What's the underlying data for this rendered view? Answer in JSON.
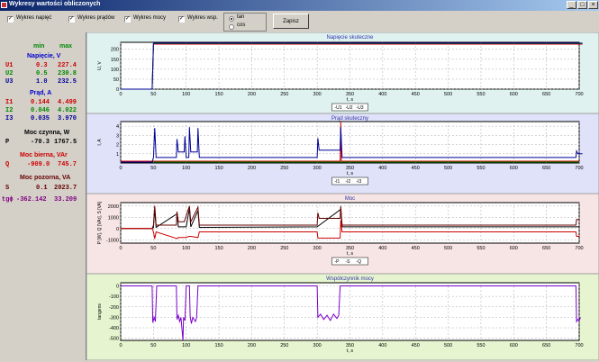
{
  "window": {
    "title": "Wykresy wartości obliczonych",
    "buttons": [
      "_",
      "□",
      "×"
    ]
  },
  "toolbar": {
    "checkboxes": [
      {
        "label": "Wykres napięć",
        "checked": true
      },
      {
        "label": "Wykres prądów",
        "checked": true
      },
      {
        "label": "Wykres mocy",
        "checked": true
      },
      {
        "label": "Wykres wsp.",
        "checked": true
      }
    ],
    "radios": [
      {
        "label": "tan",
        "selected": true
      },
      {
        "label": "cos",
        "selected": false
      }
    ],
    "save_label": "Zapisz"
  },
  "summary": {
    "col_min": "min",
    "col_max": "max",
    "sections": [
      {
        "title": "Napięcie, V",
        "title_color": "#0000cc",
        "rows": [
          {
            "label": "U1",
            "min": "0.3",
            "max": "227.4",
            "color": "#cc0000"
          },
          {
            "label": "U2",
            "min": "0.5",
            "max": "230.8",
            "color": "#008800"
          },
          {
            "label": "U3",
            "min": "1.0",
            "max": "232.5",
            "color": "#000099"
          }
        ]
      },
      {
        "title": "Prąd, A",
        "title_color": "#0000cc",
        "rows": [
          {
            "label": "I1",
            "min": "0.144",
            "max": "4.499",
            "color": "#cc0000"
          },
          {
            "label": "I2",
            "min": "0.046",
            "max": "4.022",
            "color": "#008800"
          },
          {
            "label": "I3",
            "min": "0.035",
            "max": "3.970",
            "color": "#000099"
          }
        ]
      },
      {
        "title": "Moc czynna, W",
        "title_color": "#000000",
        "rows": [
          {
            "label": "P",
            "min": "-70.3",
            "max": "1767.5",
            "color": "#000000"
          }
        ]
      },
      {
        "title": "Moc bierna, VAr",
        "title_color": "#cc0000",
        "rows": [
          {
            "label": "Q",
            "min": "-909.0",
            "max": "745.7",
            "color": "#cc0000"
          }
        ]
      },
      {
        "title": "Moc pozorna, VA",
        "title_color": "#660000",
        "rows": [
          {
            "label": "S",
            "min": "0.1",
            "max": "2023.7",
            "color": "#660000"
          }
        ]
      },
      {
        "title": "",
        "title_color": "#800080",
        "rows": [
          {
            "label": "tgɸ",
            "min": "-362.142",
            "max": "33.209",
            "color": "#800080"
          }
        ]
      }
    ]
  },
  "chart_data": [
    {
      "type": "line",
      "title": "Napięcie skuteczne",
      "ylabel": "U, V",
      "xlabel": "t, s",
      "bg": "#dff2f0",
      "xlim": [
        0,
        700
      ],
      "ylim": [
        0,
        235
      ],
      "yticks": [
        "0",
        "50",
        "100",
        "150",
        "200"
      ],
      "xticks": [
        "0",
        "50",
        "100",
        "150",
        "200",
        "250",
        "300",
        "350",
        "400",
        "450",
        "500",
        "550",
        "600",
        "650",
        "700"
      ],
      "legend": [
        "U1",
        "U2",
        "U3"
      ],
      "series": [
        {
          "name": "U1",
          "color": "#cc0000",
          "points": [
            [
              0,
              0
            ],
            [
              48,
              0
            ],
            [
              50,
              226
            ],
            [
              705,
              226
            ]
          ]
        },
        {
          "name": "U2",
          "color": "#008800",
          "points": [
            [
              0,
              0
            ],
            [
              48,
              0
            ],
            [
              50,
              229
            ],
            [
              705,
              229
            ]
          ]
        },
        {
          "name": "U3",
          "color": "#000099",
          "points": [
            [
              0,
              0
            ],
            [
              48,
              0
            ],
            [
              50,
              231
            ],
            [
              705,
              231
            ]
          ]
        }
      ]
    },
    {
      "type": "line",
      "title": "Prąd skuteczny",
      "ylabel": "I, A",
      "xlabel": "t, s",
      "bg": "#dfe2f8",
      "xlim": [
        0,
        700
      ],
      "ylim": [
        0,
        4.5
      ],
      "yticks": [
        "1",
        "2",
        "3",
        "4"
      ],
      "ytick_values": [
        1,
        2,
        3,
        4
      ],
      "xticks": [
        "0",
        "50",
        "100",
        "150",
        "200",
        "250",
        "300",
        "350",
        "400",
        "450",
        "500",
        "550",
        "600",
        "650",
        "700"
      ],
      "legend": [
        "I1",
        "I2",
        "I3"
      ],
      "series": [
        {
          "name": "I1",
          "color": "#cc0000",
          "points": [
            [
              0,
              0.2
            ],
            [
              335,
              0.2
            ],
            [
              336,
              4.5
            ],
            [
              337,
              0.2
            ],
            [
              700,
              0.2
            ]
          ]
        },
        {
          "name": "I2",
          "color": "#008800",
          "points": [
            [
              0,
              0.1
            ],
            [
              700,
              0.1
            ]
          ]
        },
        {
          "name": "I3",
          "color": "#000099",
          "points": [
            [
              0,
              0.1
            ],
            [
              48,
              0.1
            ],
            [
              50,
              0.6
            ],
            [
              52,
              3.8
            ],
            [
              54,
              0.6
            ],
            [
              85,
              0.6
            ],
            [
              86,
              2.6
            ],
            [
              88,
              1.2
            ],
            [
              97,
              1.2
            ],
            [
              98,
              2.9
            ],
            [
              100,
              0.6
            ],
            [
              104,
              0.6
            ],
            [
              105,
              3.9
            ],
            [
              107,
              1.2
            ],
            [
              117,
              1.2
            ],
            [
              118,
              3.8
            ],
            [
              120,
              0.6
            ],
            [
              300,
              0.6
            ],
            [
              301,
              2.7
            ],
            [
              303,
              1.4
            ],
            [
              335,
              1.4
            ],
            [
              336,
              3.9
            ],
            [
              338,
              0.6
            ],
            [
              695,
              0.6
            ],
            [
              696,
              1.3
            ],
            [
              698,
              1.0
            ],
            [
              705,
              1.0
            ]
          ]
        }
      ]
    },
    {
      "type": "line",
      "title": "Moc",
      "ylabel": "P [W], Q [VAr], S [VA]",
      "xlabel": "t, s",
      "bg": "#f7e4e4",
      "xlim": [
        0,
        700
      ],
      "ylim": [
        -1300,
        2300
      ],
      "yticks": [
        "-1000",
        "0",
        "1000",
        "2000"
      ],
      "ytick_values": [
        -1000,
        0,
        1000,
        2000
      ],
      "xticks": [
        "0",
        "50",
        "100",
        "150",
        "200",
        "250",
        "300",
        "350",
        "400",
        "450",
        "500",
        "550",
        "600",
        "650",
        "700"
      ],
      "legend": [
        "P",
        "S",
        "Q"
      ],
      "series": [
        {
          "name": "P",
          "color": "#000000",
          "points": [
            [
              0,
              0
            ],
            [
              48,
              0
            ],
            [
              50,
              100
            ],
            [
              52,
              1700
            ],
            [
              54,
              100
            ],
            [
              86,
              1300
            ],
            [
              88,
              150
            ],
            [
              100,
              150
            ],
            [
              105,
              1767
            ],
            [
              107,
              150
            ],
            [
              118,
              1600
            ],
            [
              120,
              100
            ],
            [
              300,
              150
            ],
            [
              336,
              1700
            ],
            [
              338,
              150
            ],
            [
              700,
              150
            ]
          ]
        },
        {
          "name": "S",
          "color": "#660000",
          "points": [
            [
              0,
              0
            ],
            [
              48,
              0
            ],
            [
              50,
              300
            ],
            [
              52,
              2023
            ],
            [
              54,
              300
            ],
            [
              85,
              300
            ],
            [
              86,
              1500
            ],
            [
              88,
              600
            ],
            [
              97,
              600
            ],
            [
              105,
              2000
            ],
            [
              107,
              600
            ],
            [
              118,
              1900
            ],
            [
              120,
              300
            ],
            [
              300,
              300
            ],
            [
              301,
              1400
            ],
            [
              303,
              900
            ],
            [
              335,
              900
            ],
            [
              336,
              2000
            ],
            [
              338,
              300
            ],
            [
              695,
              300
            ],
            [
              696,
              800
            ],
            [
              700,
              800
            ]
          ]
        },
        {
          "name": "Q",
          "color": "#cc0000",
          "points": [
            [
              0,
              0
            ],
            [
              48,
              0
            ],
            [
              50,
              -300
            ],
            [
              52,
              -909
            ],
            [
              54,
              -300
            ],
            [
              86,
              -900
            ],
            [
              88,
              -800
            ],
            [
              100,
              -800
            ],
            [
              104,
              -700
            ],
            [
              107,
              -700
            ],
            [
              118,
              -800
            ],
            [
              120,
              -300
            ],
            [
              300,
              -300
            ],
            [
              301,
              -850
            ],
            [
              335,
              -850
            ],
            [
              336,
              745
            ],
            [
              338,
              -300
            ],
            [
              695,
              -300
            ],
            [
              696,
              -700
            ],
            [
              700,
              -700
            ]
          ]
        }
      ]
    },
    {
      "type": "line",
      "title": "Współczynnik mocy",
      "ylabel": "tangens",
      "xlabel": "t, s",
      "bg": "#e6f5d0",
      "xlim": [
        0,
        700
      ],
      "ylim": [
        -520,
        30
      ],
      "yticks": [
        "0",
        "-100",
        "-200",
        "-300",
        "-400",
        "-500"
      ],
      "ytick_values": [
        0,
        -100,
        -200,
        -300,
        -400,
        -500
      ],
      "xticks": [
        "0",
        "50",
        "100",
        "150",
        "200",
        "250",
        "300",
        "350",
        "400",
        "450",
        "500",
        "550",
        "600",
        "650",
        "700"
      ],
      "legend": [],
      "series": [
        {
          "name": "tgɸ",
          "color": "#7a00cc",
          "points": [
            [
              0,
              0
            ],
            [
              48,
              0
            ],
            [
              49,
              -350
            ],
            [
              51,
              -300
            ],
            [
              53,
              -340
            ],
            [
              55,
              0
            ],
            [
              85,
              0
            ],
            [
              86,
              -320
            ],
            [
              88,
              -280
            ],
            [
              90,
              -340
            ],
            [
              92,
              -300
            ],
            [
              95,
              -520
            ],
            [
              96,
              -300
            ],
            [
              98,
              -330
            ],
            [
              100,
              0
            ],
            [
              105,
              0
            ],
            [
              106,
              -290
            ],
            [
              108,
              -360
            ],
            [
              110,
              -300
            ],
            [
              114,
              -340
            ],
            [
              116,
              -300
            ],
            [
              118,
              0
            ],
            [
              300,
              0
            ],
            [
              301,
              -300
            ],
            [
              305,
              -270
            ],
            [
              310,
              -320
            ],
            [
              315,
              -280
            ],
            [
              320,
              -330
            ],
            [
              325,
              -270
            ],
            [
              330,
              -310
            ],
            [
              333,
              -280
            ],
            [
              335,
              0
            ],
            [
              695,
              0
            ],
            [
              696,
              -340
            ],
            [
              698,
              -320
            ],
            [
              700,
              -330
            ],
            [
              702,
              -300
            ]
          ]
        }
      ]
    }
  ]
}
